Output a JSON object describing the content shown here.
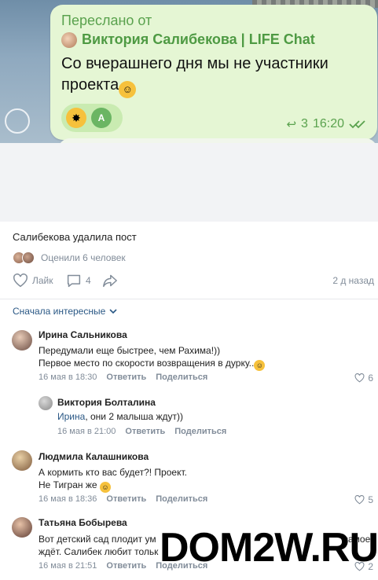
{
  "telegram": {
    "forwarded_label": "Переслано от",
    "forwarded_from": "Виктория Салибекова | LIFE Chat",
    "message_line1": "Со вчерашнего дня мы не участники",
    "message_line2": "проекта",
    "reaction_avatar_letter": "A",
    "reply_count": "3",
    "time": "16:20",
    "accent_color": "#5aa24e",
    "bubble_color": "#e5f6d4"
  },
  "post": {
    "text": "Салибекова удалила пост",
    "liked_by": "Оценили 6 человек",
    "like_label": "Лайк",
    "comments_count": "4",
    "time": "2 д назад"
  },
  "comments_header": {
    "sort_label": "Сначала интересные"
  },
  "comments": [
    {
      "author": "Ирина Сальникова",
      "line1": "Передумали еще быстрее, чем Рахима!))",
      "line2": "Первое место по скорости возвращения в дурку..",
      "date": "16 мая в 18:30",
      "reply": "Ответить",
      "share": "Поделиться",
      "likes": "6"
    },
    {
      "author": "Виктория Болталина",
      "mention": "Ирина",
      "line1": ", они 2 малыша ждут))",
      "date": "16 мая в 21:00",
      "reply": "Ответить",
      "share": "Поделиться"
    },
    {
      "author": "Людмила Калашникова",
      "line1": "А кормить кто вас будет?! Проект.",
      "line2": "Не Тигран же",
      "date": "16 мая в 18:36",
      "reply": "Ответить",
      "share": "Поделиться",
      "likes": "5"
    },
    {
      "author": "Татьяна Бобырева",
      "line1": "Вот детский сад плодит ум",
      "line1_tail": "самое",
      "line2": "ждёт. Салибек любит тольк",
      "date": "16 мая в 21:51",
      "reply": "Ответить",
      "share": "Поделиться",
      "likes": "2"
    }
  ],
  "watermark": "DOM2W.RU",
  "icons": [
    "heart-icon",
    "comment-icon",
    "share-icon",
    "chevron-down-icon",
    "reply-arrow-icon",
    "double-check-icon"
  ]
}
